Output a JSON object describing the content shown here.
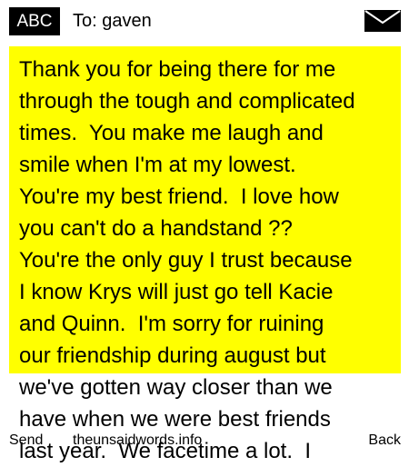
{
  "header": {
    "input_mode": "ABC",
    "to_label": "To: gaven",
    "icon": "envelope-icon"
  },
  "message": {
    "lines": [
      "Thank you for being there for me",
      "through the tough and complicated",
      "times.  You make me laugh and",
      "smile when I'm at my lowest.",
      "You're my best friend.  I love how",
      "you can't do a handstand ??",
      "You're the only guy I trust because",
      "I know Krys will just go tell Kacie",
      "and Quinn.  I'm sorry for ruining",
      "our friendship during august but",
      "we've gotten way closer than we",
      "have when we were best friends",
      "last year.  We facetime a lot.  I"
    ]
  },
  "softkeys": {
    "left": "Send",
    "center": "theunsaidwords.info",
    "right": "Back"
  },
  "colors": {
    "highlight": "#ffff00",
    "badge": "#000000"
  }
}
